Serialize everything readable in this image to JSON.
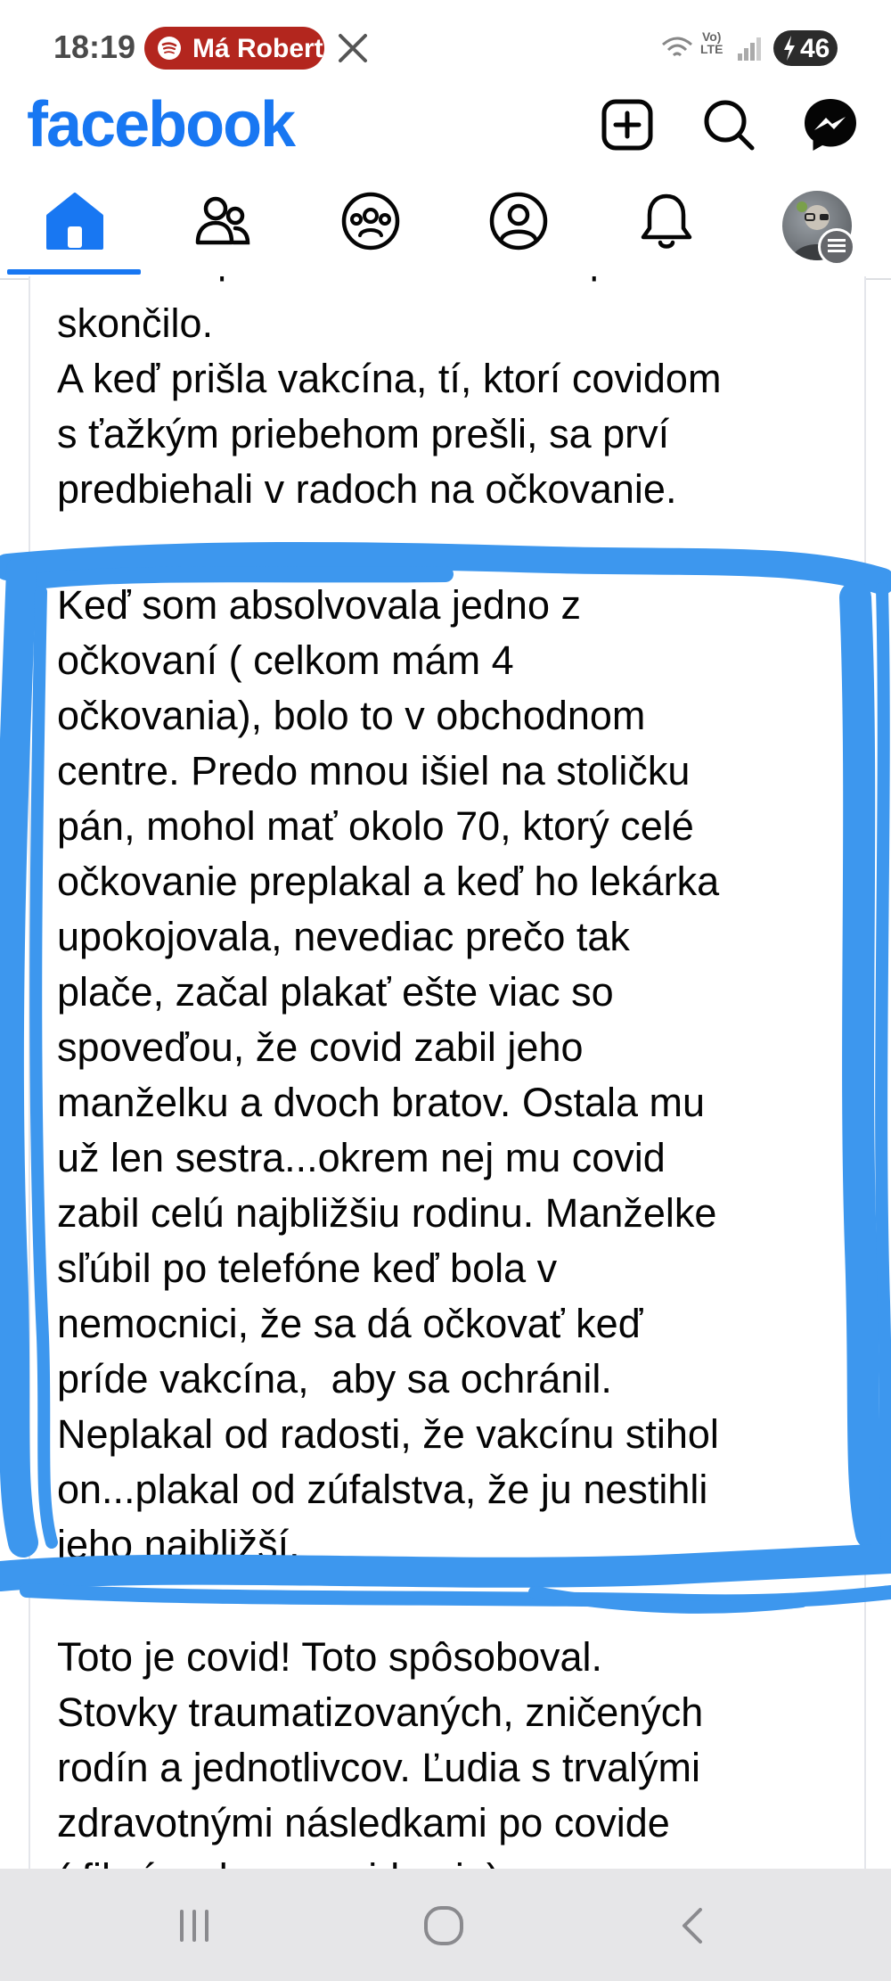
{
  "status_bar": {
    "time": "18:19",
    "now_playing": "Má Robert",
    "battery": "46",
    "network": [
      "Vo)",
      "LTE"
    ]
  },
  "header": {
    "logo": "facebook",
    "actions": [
      "create-icon",
      "search-icon",
      "messenger-icon"
    ]
  },
  "tabs": [
    {
      "name": "home",
      "icon": "home-icon",
      "active": true
    },
    {
      "name": "friends",
      "icon": "friends-icon",
      "active": false
    },
    {
      "name": "groups",
      "icon": "groups-icon",
      "active": false
    },
    {
      "name": "profile",
      "icon": "profile-icon",
      "active": false
    },
    {
      "name": "notifications",
      "icon": "bell-icon",
      "active": false
    },
    {
      "name": "menu",
      "icon": "avatar",
      "active": false
    }
  ],
  "post": {
    "cut_top_line": "mesiace po tom ako celé toto peklo",
    "paragraph1": "skončilo.\nA keď prišla vakcína, tí, ktorí covidom\ns ťažkým priebehom prešli, sa prví\npredbiehali v radoch na očkovanie.",
    "paragraph2": "Keď som absolvovala jedno z\nočkovaní ( celkom mám 4\nočkovania), bolo to v obchodnom\ncentre. Predo mnou išiel na stoličku\npán, mohol mať okolo 70, ktorý celé\nočkovanie preplakal a keď ho lekárka\nupokojovala, nevediac prečo tak\nplače, začal plakať ešte viac so\nspoveďou, že covid zabil jeho\nmanželku a dvoch bratov. Ostala mu\nuž len sestra...okrem nej mu covid\nzabil celú najbližšiu rodinu. Manželke\nsľúbil po telefóne keď bola v\nnemocnici, že sa dá očkovať keď\npríde vakcína,  aby sa ochránil.\nNeplakal od radosti, že vakcínu stihol\non...plakal od zúfalstva, že ju nestihli\njeho najbližší.",
    "paragraph3": "Toto je covid! Toto spôsoboval.\nStovky traumatizovaných, zničených\nrodín a jednotlivcov. Ľudia s trvalými\nzdravotnými následkami po covide\n( fibrózy, long covid, a i. )"
  },
  "colors": {
    "brand": "#1877f2",
    "highlight": "#3d97ee",
    "pill": "#b3261e"
  },
  "nav": [
    "recents-icon",
    "home-circle-icon",
    "back-icon"
  ]
}
